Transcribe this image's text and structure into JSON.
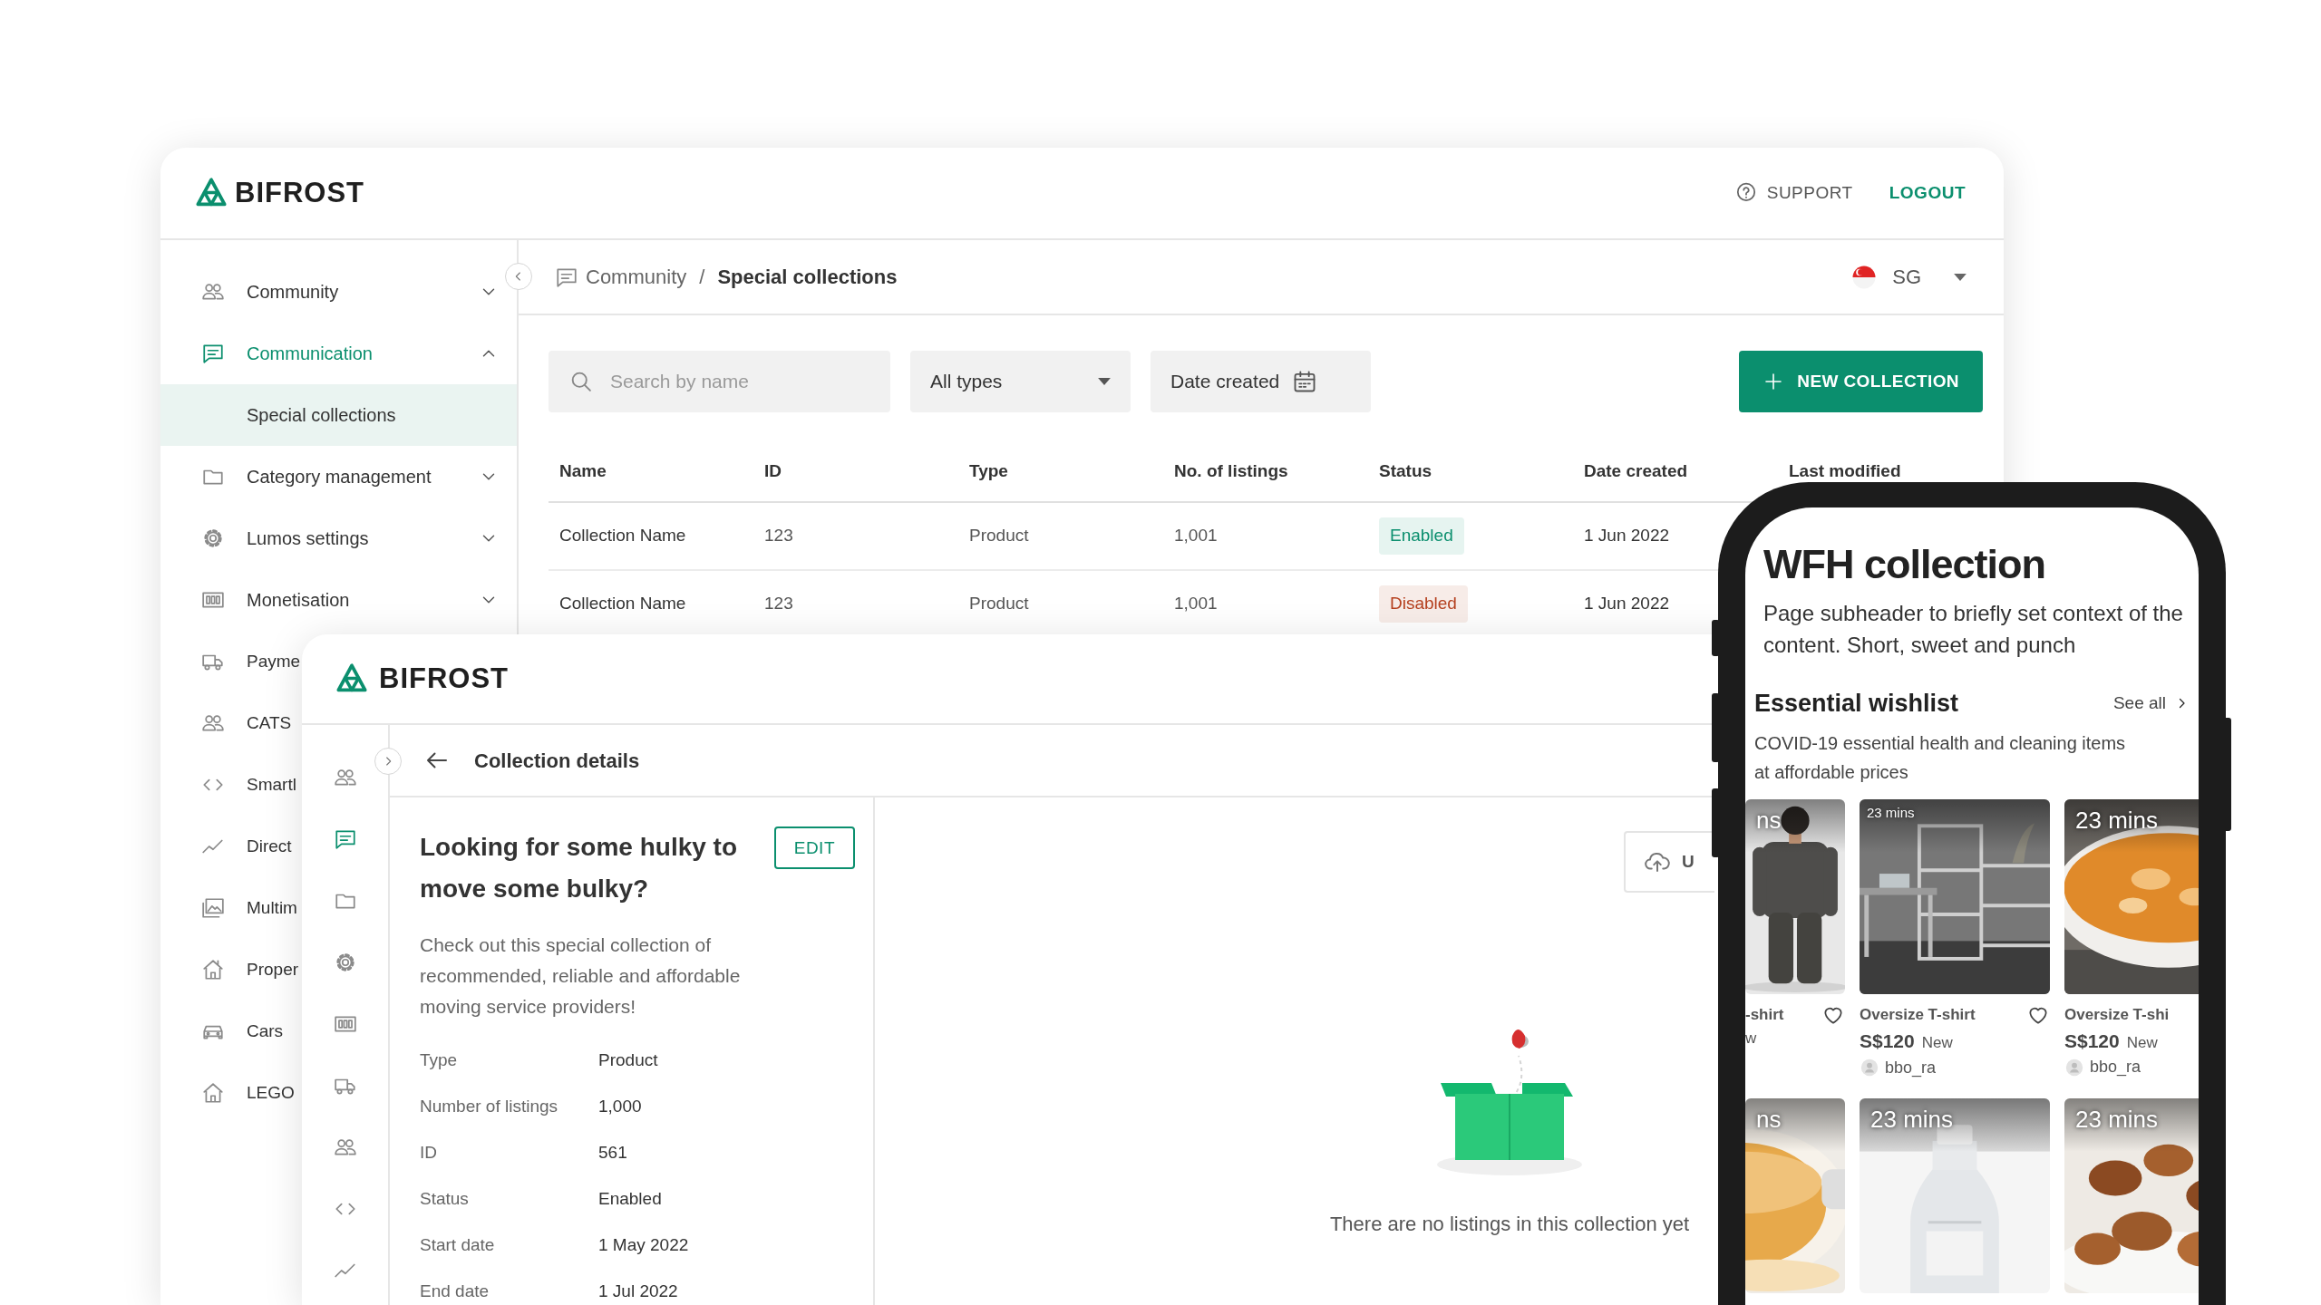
{
  "app_window": {
    "logo": "BIFROST",
    "header_links": [
      {
        "label": "SUPPORT",
        "kind": "support"
      },
      {
        "label": "LOGOUT",
        "kind": "logout"
      }
    ],
    "sidebar": {
      "items": [
        {
          "label": "Community",
          "selected": false,
          "expanded": false
        },
        {
          "label": "Communication",
          "selected": true,
          "expanded": true,
          "children": [
            {
              "label": "Special collections",
              "selected": true
            }
          ]
        },
        {
          "label": "Category management",
          "selected": false,
          "expanded": false
        },
        {
          "label": "Lumos settings",
          "selected": false,
          "expanded": false
        },
        {
          "label": "Monetisation",
          "selected": false,
          "expanded": false
        },
        {
          "label": "Payme",
          "selected": false
        },
        {
          "label": "CATS",
          "selected": false
        },
        {
          "label": "Smartl",
          "selected": false
        },
        {
          "label": "Direct",
          "selected": false
        },
        {
          "label": "Multim",
          "selected": false
        },
        {
          "label": "Proper",
          "selected": false
        },
        {
          "label": "Cars",
          "selected": false
        },
        {
          "label": "LEGO",
          "selected": false
        }
      ]
    },
    "breadcrumb": {
      "parent": "Community",
      "separator": "/",
      "current": "Special collections"
    },
    "country": "SG",
    "toolbar": {
      "search": {
        "placeholder": "Search by name"
      },
      "type_filter": "All types",
      "date_filter": "Date created",
      "new_button": "NEW COLLECTION"
    },
    "table": {
      "columns": [
        "Name",
        "ID",
        "Type",
        "No. of listings",
        "Status",
        "Date created",
        "Last modified"
      ],
      "rows": [
        {
          "name": "Collection Name",
          "id": "123",
          "type": "Product",
          "listings": "1,001",
          "status": "Enabled",
          "color": "#0b8f6e",
          "date_created": "1 Jun 2022"
        },
        {
          "name": "Collection Name",
          "id": "123",
          "type": "Product",
          "listings": "1,001",
          "status": "Disabled",
          "color": "#b5401f",
          "date_created": "1 Jun 2022"
        }
      ]
    }
  },
  "details_window": {
    "logo": "BIFROST",
    "rail": [
      {
        "selected": false
      },
      {
        "selected": true
      },
      {
        "selected": false
      },
      {
        "selected": false
      },
      {
        "selected": false
      },
      {
        "selected": false
      },
      {
        "selected": false
      },
      {
        "selected": false
      },
      {
        "selected": false
      }
    ],
    "page_title": "Collection details",
    "title": "Looking for some hulky to move some bulky?",
    "edit_button": "EDIT",
    "description": "Check out this special collection of recommended, reliable and affordable moving service providers!",
    "fields": [
      {
        "label": "Type",
        "value": "Product"
      },
      {
        "label": "Number of listings",
        "value": "1,000"
      },
      {
        "label": "ID",
        "value": "561"
      },
      {
        "label": "Status",
        "value": "Enabled"
      },
      {
        "label": "Start date",
        "value": "1 May 2022"
      },
      {
        "label": "End date",
        "value": "1 Jul 2022"
      }
    ],
    "upload_button": "U",
    "empty_message": "There are no listings in this collection yet"
  },
  "phone": {
    "title": "WFH collection",
    "subtitle": "Page subheader to briefly set context of the content. Short, sweet and punch",
    "section": {
      "title": "Essential wishlist",
      "see_all": "See all",
      "description": "COVID-19 essential health and cleaning items at affordable prices"
    },
    "cards": [
      {
        "badge": "ns",
        "kind": "large",
        "title": "-shirt",
        "condition": "w",
        "favorite": true
      },
      {
        "badge": "23 mins",
        "kind": "small",
        "title": "Oversize T-shirt",
        "price": "S$120",
        "condition": "New",
        "seller": "bbo_ra",
        "favorite": true
      },
      {
        "badge": "23 mins",
        "kind": "large",
        "title": "Oversize T-shi",
        "price": "S$120",
        "condition": "New",
        "seller": "bbo_ra"
      }
    ],
    "more_cards": [
      {
        "badge": "ns",
        "kind": "large"
      },
      {
        "badge": "23 mins",
        "kind": "large"
      },
      {
        "badge": "23 mins",
        "kind": "large"
      }
    ]
  }
}
